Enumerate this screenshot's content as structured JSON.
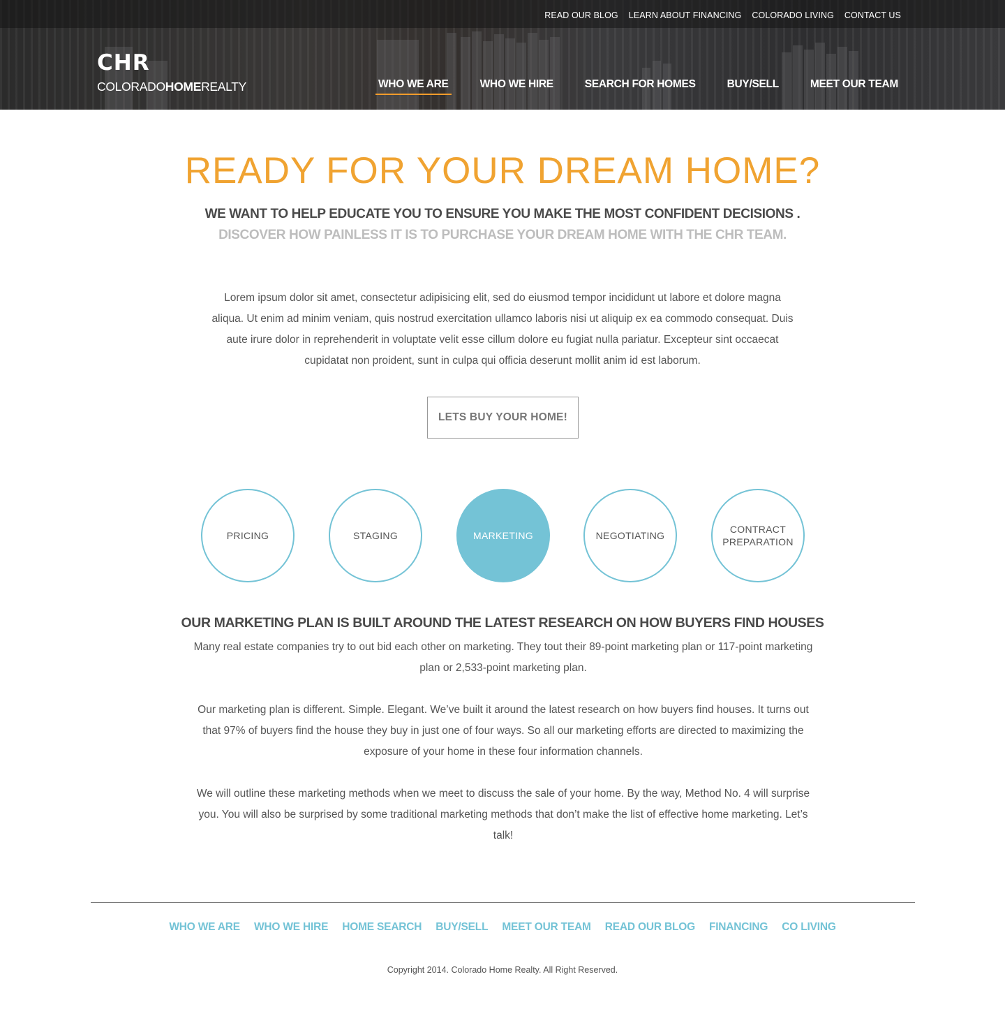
{
  "top_links": [
    "READ OUR BLOG",
    "LEARN ABOUT FINANCING",
    "COLORADO LIVING",
    "CONTACT US"
  ],
  "logo": {
    "mark": "CHR",
    "word_a": "COLORADO",
    "word_b": "HOME",
    "word_c": "REALTY"
  },
  "nav": [
    {
      "label": "WHO WE ARE",
      "active": true
    },
    {
      "label": "WHO WE HIRE",
      "active": false
    },
    {
      "label": "SEARCH FOR HOMES",
      "active": false
    },
    {
      "label": "BUY/SELL",
      "active": false
    },
    {
      "label": "MEET OUR TEAM",
      "active": false
    }
  ],
  "hero": {
    "title": "READY FOR YOUR DREAM HOME?",
    "subhead_1": "WE WANT TO HELP EDUCATE YOU TO ENSURE YOU MAKE THE MOST CONFIDENT DECISIONS .",
    "subhead_2": "DISCOVER HOW PAINLESS IT IS TO PURCHASE YOUR DREAM HOME WITH THE CHR TEAM.",
    "intro": "Lorem ipsum dolor sit amet, consectetur adipisicing elit, sed do eiusmod tempor incididunt ut labore et dolore magna aliqua. Ut enim ad minim veniam, quis nostrud exercitation ullamco laboris nisi ut aliquip ex ea commodo consequat. Duis aute irure dolor in reprehenderit in voluptate velit esse cillum dolore eu fugiat nulla pariatur. Excepteur sint occaecat cupidatat non proident, sunt in culpa qui officia deserunt mollit anim id est laborum.",
    "cta": "LETS BUY YOUR HOME!"
  },
  "steps": [
    {
      "label": "PRICING",
      "active": false
    },
    {
      "label": "STAGING",
      "active": false
    },
    {
      "label": "MARKETING",
      "active": true
    },
    {
      "label": "NEGOTIATING",
      "active": false
    },
    {
      "label": "CONTRACT\nPREPARATION",
      "active": false
    }
  ],
  "marketing": {
    "title": "OUR MARKETING PLAN IS BUILT AROUND THE LATEST RESEARCH ON HOW BUYERS FIND HOUSES",
    "p1": "Many real estate companies try to out bid each other on marketing. They tout their 89-point marketing plan or 117-point marketing plan or 2,533-point marketing plan.",
    "p2": "Our marketing plan is different. Simple. Elegant. We’ve built it around the latest research on how buyers find houses. It turns out that 97% of buyers find the house they buy in just one of four ways. So all our marketing efforts are directed to maximizing the exposure of your home in these four information channels.",
    "p3": "We will outline these marketing methods when we meet to discuss the sale of your home. By the way, Method No. 4 will surprise you. You will also be surprised by some traditional marketing methods that don’t make the list of effective home marketing. Let’s talk!"
  },
  "footer": {
    "links": [
      "WHO WE ARE",
      "WHO WE HIRE",
      "HOME SEARCH",
      "BUY/SELL",
      "MEET OUR TEAM",
      "READ OUR BLOG",
      "FINANCING",
      "CO LIVING"
    ],
    "copyright": "Copyright 2014. Colorado Home Realty. All Right Reserved."
  },
  "colors": {
    "accent_orange": "#f0a331",
    "accent_blue": "#74c3d6",
    "header_dark": "#2e2e30"
  }
}
